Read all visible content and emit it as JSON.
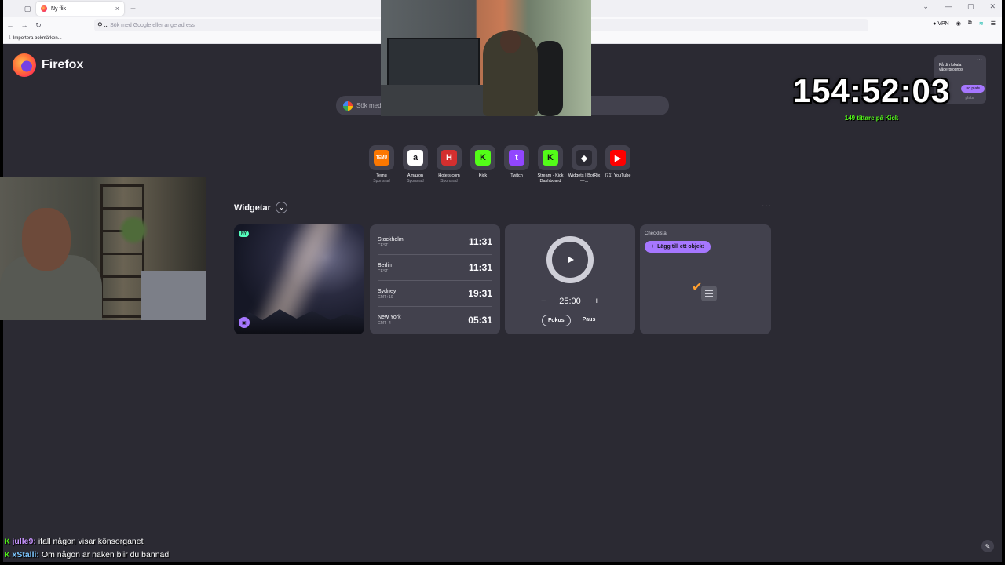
{
  "browser": {
    "tab_title": "Ny flik",
    "url_placeholder": "Sök med Google eller ange adress",
    "vpn_label": "VPN",
    "bookmark_import": "Importera bokmärken..."
  },
  "brand": {
    "name": "Firefox"
  },
  "search": {
    "placeholder": "Sök med G"
  },
  "top_sites": [
    {
      "name": "Temu",
      "sub": "Sponsrad",
      "icon": "TEMU",
      "color": "#fb7701"
    },
    {
      "name": "Amazon",
      "sub": "Sponsrad",
      "icon": "a",
      "color": "#ffffff"
    },
    {
      "name": "Hotels.com",
      "sub": "Sponsrad",
      "icon": "H",
      "color": "#d32f2f"
    },
    {
      "name": "Kick",
      "sub": "",
      "icon": "K",
      "color": "#53fc18"
    },
    {
      "name": "Twitch",
      "sub": "",
      "icon": "t",
      "color": "#9146ff"
    },
    {
      "name": "Stream - Kick Dashboard",
      "sub": "",
      "icon": "K",
      "color": "#53fc18"
    },
    {
      "name": "Widgets | BotRix —...",
      "sub": "",
      "icon": "◆",
      "color": "#2b2a33"
    },
    {
      "name": "(71) YouTube",
      "sub": "",
      "icon": "▶",
      "color": "#ff0000"
    }
  ],
  "widgets": {
    "title": "Widgetar",
    "photo_badge": "NY",
    "clocks": [
      {
        "city": "Stockholm",
        "tz": "CEST",
        "time": "11:31"
      },
      {
        "city": "Berlin",
        "tz": "CEST",
        "time": "11:31"
      },
      {
        "city": "Sydney",
        "tz": "GMT+10",
        "time": "19:31"
      },
      {
        "city": "New York",
        "tz": "GMT−4",
        "time": "05:31"
      }
    ],
    "timer": {
      "minus": "−",
      "time": "25:00",
      "plus": "+",
      "focus": "Fokus",
      "pause": "Paus"
    },
    "checklist": {
      "title": "Checklista",
      "add_label": "Lägg till ett objekt"
    }
  },
  "weather": {
    "prompt": "Få din lokala väderprognos",
    "button": "nd plats",
    "sub": "plats"
  },
  "overlay": {
    "stream_timer": "154:52:03",
    "viewers": "149 tittare på Kick"
  },
  "chat": [
    {
      "user": "julle9:",
      "user_color": "#c792ff",
      "text": "ifall någon visar könsorganet"
    },
    {
      "user": "xStalli:",
      "user_color": "#7cc6ff",
      "text": "Om någon är naken blir du bannad"
    }
  ],
  "colors": {
    "accent": "#a677ff",
    "kick": "#53fc18",
    "page_bg": "#2b2a33",
    "card_bg": "#42414d"
  }
}
